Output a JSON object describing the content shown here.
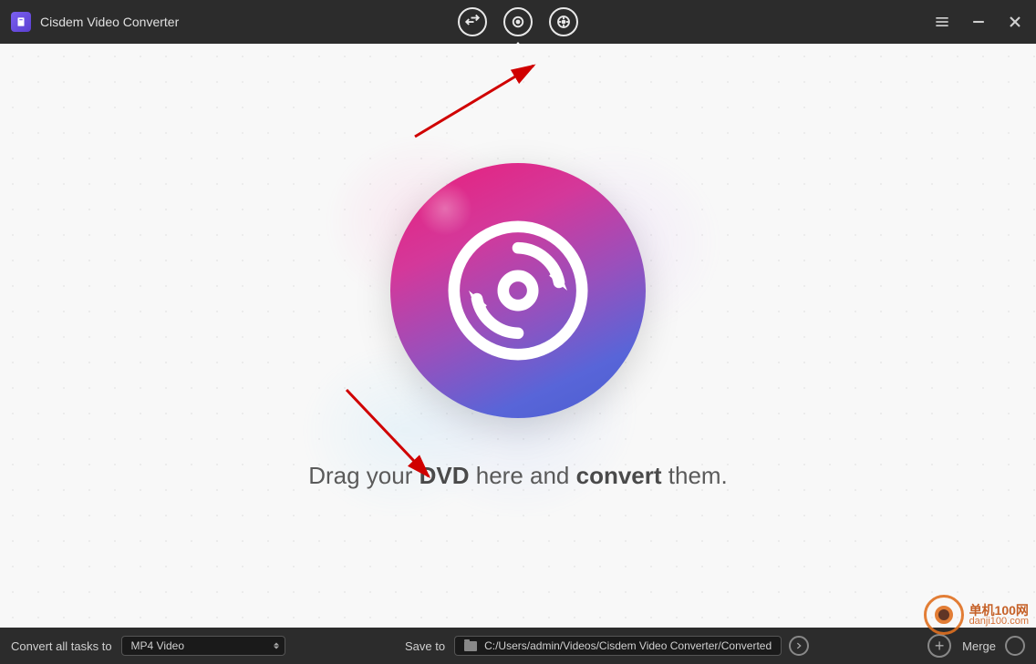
{
  "titlebar": {
    "app_name": "Cisdem Video Converter"
  },
  "main": {
    "drop_prefix": "Drag your ",
    "drop_strong1": "DVD",
    "drop_mid": " here and ",
    "drop_strong2": "convert",
    "drop_suffix": " them."
  },
  "bottombar": {
    "convert_label": "Convert all tasks to",
    "format_selected": "MP4 Video",
    "save_label": "Save to",
    "save_path": "C:/Users/admin/Videos/Cisdem Video Converter/Converted",
    "merge_label": "Merge"
  },
  "watermark": {
    "text_cn": "单机100网",
    "text_url": "danji100.com"
  }
}
